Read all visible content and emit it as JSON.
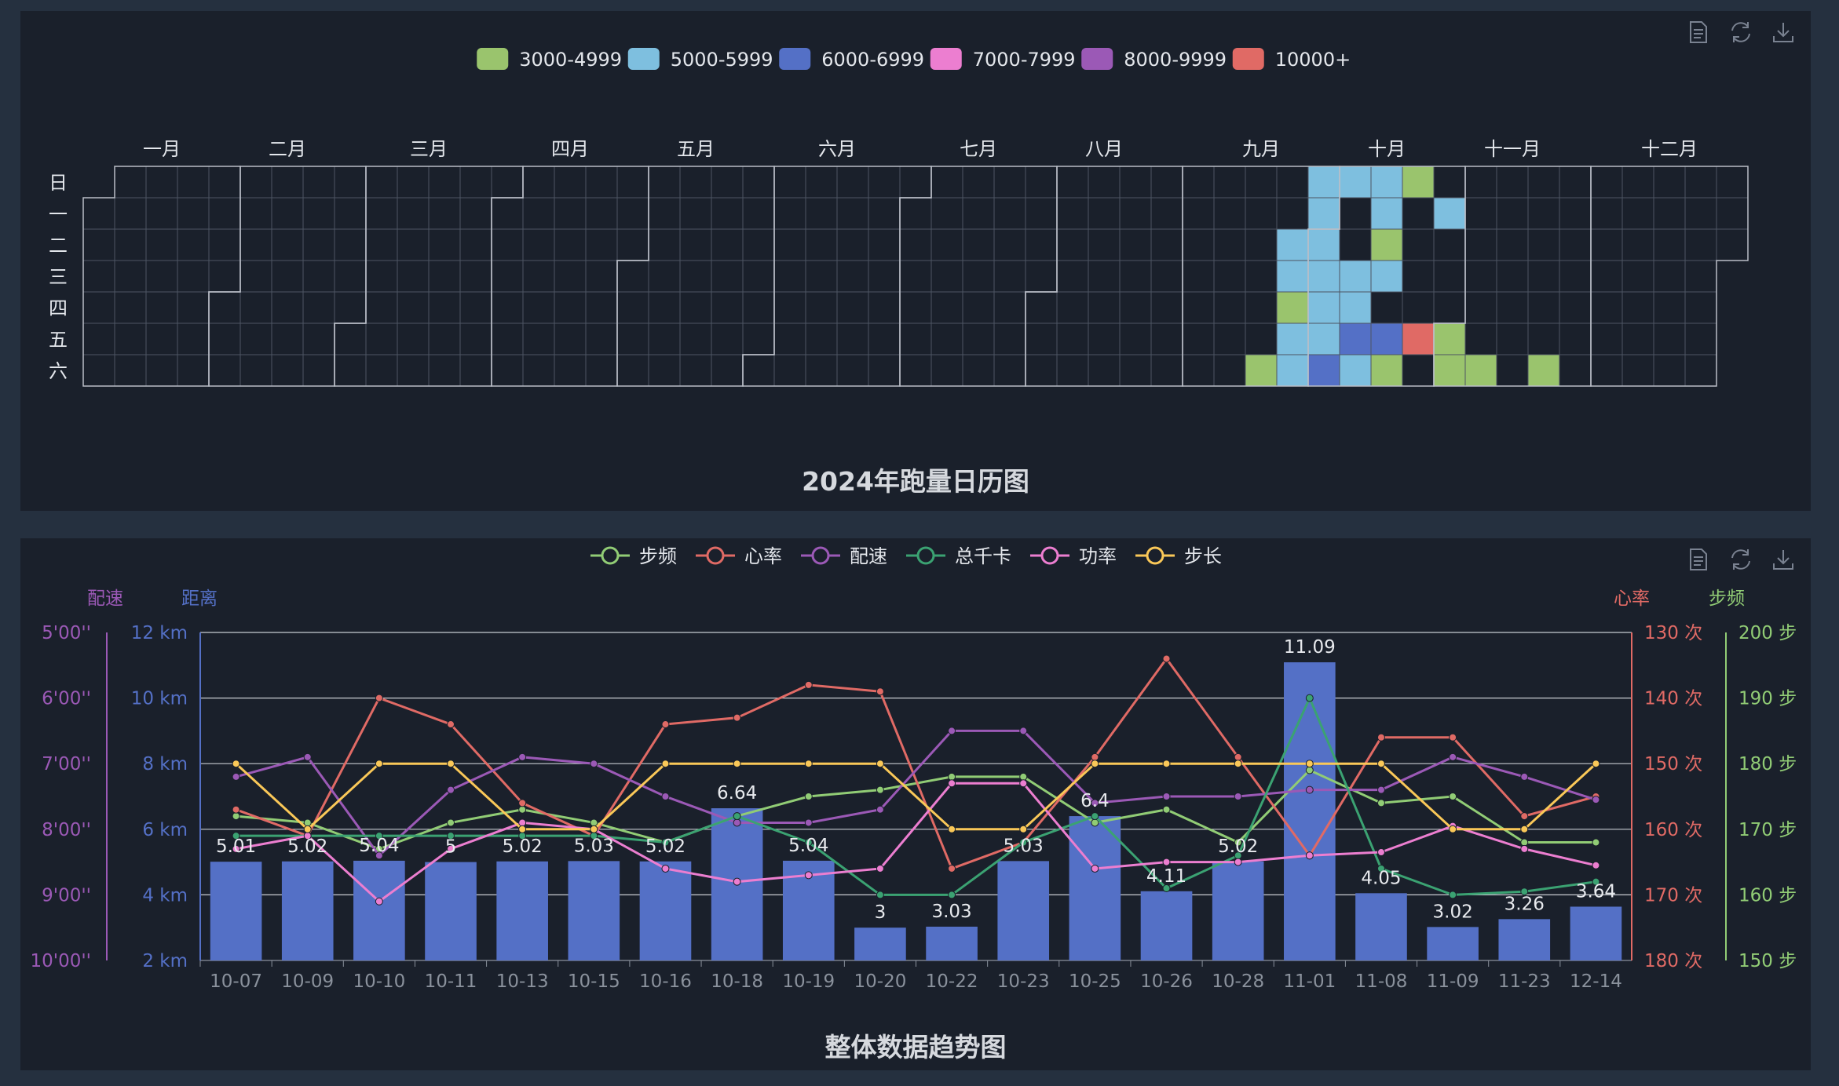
{
  "calendar": {
    "title": "2024年跑量日历图",
    "year": 2024,
    "legend": [
      {
        "label": "3000-4999",
        "color": "#9ac46d"
      },
      {
        "label": "5000-5999",
        "color": "#7ebfdf"
      },
      {
        "label": "6000-6999",
        "color": "#5470c6"
      },
      {
        "label": "7000-7999",
        "color": "#ec7ed0"
      },
      {
        "label": "8000-9999",
        "color": "#9b59b6"
      },
      {
        "label": "10000+",
        "color": "#e06a65"
      }
    ],
    "months": [
      "一月",
      "二月",
      "三月",
      "四月",
      "五月",
      "六月",
      "七月",
      "八月",
      "九月",
      "十月",
      "十一月",
      "十二月"
    ],
    "weekdays": [
      "日",
      "一",
      "二",
      "三",
      "四",
      "五",
      "六"
    ],
    "days": [
      [
        "2024-09-21",
        "3000-4999"
      ],
      [
        "2024-09-26",
        "3000-4999"
      ],
      [
        "2024-09-24",
        "5000-5999"
      ],
      [
        "2024-09-25",
        "5000-5999"
      ],
      [
        "2024-09-27",
        "5000-5999"
      ],
      [
        "2024-09-28",
        "5000-5999"
      ],
      [
        "2024-09-29",
        "5000-5999"
      ],
      [
        "2024-09-30",
        "5000-5999"
      ],
      [
        "2024-10-01",
        "5000-5999"
      ],
      [
        "2024-10-02",
        "5000-5999"
      ],
      [
        "2024-10-03",
        "5000-5999"
      ],
      [
        "2024-10-04",
        "5000-5999"
      ],
      [
        "2024-10-05",
        "6000-6999"
      ],
      [
        "2024-10-06",
        "5000-5999"
      ],
      [
        "2024-10-09",
        "5000-5999"
      ],
      [
        "2024-10-10",
        "5000-5999"
      ],
      [
        "2024-10-11",
        "6000-6999"
      ],
      [
        "2024-10-12",
        "5000-5999"
      ],
      [
        "2024-10-13",
        "5000-5999"
      ],
      [
        "2024-10-14",
        "5000-5999"
      ],
      [
        "2024-10-15",
        "3000-4999"
      ],
      [
        "2024-10-16",
        "5000-5999"
      ],
      [
        "2024-10-18",
        "6000-6999"
      ],
      [
        "2024-10-19",
        "3000-4999"
      ],
      [
        "2024-10-20",
        "3000-4999"
      ],
      [
        "2024-10-25",
        "10000+"
      ],
      [
        "2024-10-28",
        "5000-5999"
      ],
      [
        "2024-11-01",
        "3000-4999"
      ],
      [
        "2024-11-02",
        "3000-4999"
      ],
      [
        "2024-11-09",
        "3000-4999"
      ],
      [
        "2024-11-23",
        "3000-4999"
      ]
    ]
  },
  "trend": {
    "title": "整体数据趋势图",
    "legend": [
      {
        "label": "步频",
        "color": "#91cc75"
      },
      {
        "label": "心率",
        "color": "#e06a65"
      },
      {
        "label": "配速",
        "color": "#9b59b6"
      },
      {
        "label": "总千卡",
        "color": "#3ba272"
      },
      {
        "label": "功率",
        "color": "#ec7ed0"
      },
      {
        "label": "步长",
        "color": "#fac858"
      }
    ],
    "axis_names": {
      "pace": "配速",
      "distance": "距离",
      "heart": "心率",
      "cadence": "步频"
    },
    "pace_ticks": [
      "5'00''",
      "6'00''",
      "7'00''",
      "8'00''",
      "9'00''",
      "10'00''"
    ],
    "distance_ticks": [
      "12 km",
      "10 km",
      "8 km",
      "6 km",
      "4 km",
      "2 km"
    ],
    "heart_ticks": [
      "130 次",
      "140 次",
      "150 次",
      "160 次",
      "170 次",
      "180 次"
    ],
    "cadence_ticks": [
      "200 步",
      "190 步",
      "180 步",
      "170 步",
      "160 步",
      "150 步"
    ],
    "colors": {
      "bar": "#5470c6",
      "pace_axis": "#9b59b6",
      "distance_axis": "#5470c6",
      "heart_axis": "#e06a65",
      "cadence_axis": "#91cc75"
    }
  },
  "chart_data": [
    {
      "type": "heatmap",
      "title": "2024年跑量日历图",
      "note_range": "2024-01-01 to 2024-12-31",
      "categories": [
        "3000-4999",
        "5000-5999",
        "6000-6999",
        "7000-7999",
        "8000-9999",
        "10000+"
      ]
    },
    {
      "type": "bar",
      "title": "整体数据趋势图",
      "categories": [
        "10-07",
        "10-09",
        "10-10",
        "10-11",
        "10-13",
        "10-15",
        "10-16",
        "10-18",
        "10-19",
        "10-20",
        "10-22",
        "10-23",
        "10-25",
        "10-26",
        "10-28",
        "11-01",
        "11-08",
        "11-09",
        "11-23",
        "12-14"
      ],
      "distance_labels": [
        "5.01",
        "5.02",
        "5.04",
        "5",
        "5.02",
        "5.03",
        "5.02",
        "6.64",
        "5.04",
        "3",
        "3.03",
        "5.03",
        "6.4",
        "4.11",
        "5.02",
        "11.09",
        "4.05",
        "3.02",
        "3.26",
        "3.64"
      ],
      "distance_km": [
        5.01,
        5.02,
        5.04,
        5,
        5.02,
        5.03,
        5.02,
        6.64,
        5.04,
        3,
        3.03,
        5.03,
        6.4,
        4.11,
        5.02,
        11.09,
        4.05,
        3.02,
        3.26,
        3.64
      ],
      "distance_range": [
        2,
        12
      ],
      "series": [
        {
          "name": "步频",
          "axis": "cadence",
          "range": [
            150,
            200
          ],
          "values": [
            172,
            171,
            167,
            171,
            173,
            171,
            168,
            172,
            175,
            176,
            178,
            178,
            171,
            173,
            168,
            179,
            174,
            175,
            168,
            168
          ]
        },
        {
          "name": "心率",
          "axis": "heart",
          "range": [
            130,
            180
          ],
          "values": [
            157,
            161,
            140,
            144,
            156,
            161,
            144,
            143,
            138,
            139,
            166,
            162,
            149,
            134,
            149,
            164,
            146,
            146,
            158,
            155
          ]
        },
        {
          "name": "配速",
          "axis": "pace",
          "range": [
            5,
            10
          ],
          "values": [
            7.2,
            6.9,
            8.4,
            7.4,
            6.9,
            7,
            7.5,
            7.9,
            7.9,
            7.7,
            6.5,
            6.5,
            7.6,
            7.5,
            7.5,
            7.4,
            7.4,
            6.9,
            7.2,
            7.55
          ]
        },
        {
          "name": "总千卡",
          "axis": "cadence",
          "range": [
            150,
            200
          ],
          "values": [
            169,
            169,
            169,
            169,
            169,
            169,
            168,
            172,
            168,
            160,
            160,
            168,
            172,
            161,
            166,
            190,
            164,
            160,
            160.5,
            162
          ]
        },
        {
          "name": "功率",
          "axis": "pace",
          "range": [
            5,
            10
          ],
          "values": [
            8.3,
            8.1,
            9.1,
            8.3,
            7.9,
            8,
            8.6,
            8.8,
            8.7,
            8.6,
            7.3,
            7.3,
            8.6,
            8.5,
            8.5,
            8.4,
            8.35,
            7.95,
            8.3,
            8.55
          ]
        },
        {
          "name": "步长",
          "axis": "heart",
          "range": [
            180,
            130
          ],
          "values": [
            160,
            150,
            160,
            160,
            150,
            150,
            160,
            160,
            160,
            160,
            150,
            150,
            160,
            160,
            160,
            160,
            160,
            150,
            150,
            160
          ]
        }
      ]
    }
  ]
}
